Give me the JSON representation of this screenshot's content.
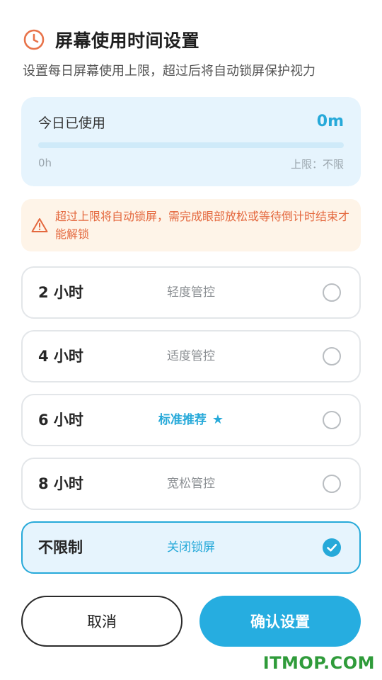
{
  "header": {
    "title": "屏幕使用时间设置",
    "subtitle": "设置每日屏幕使用上限，超过后将自动锁屏保护视力",
    "icon": "clock-icon",
    "accent_color": "#e8734a"
  },
  "usage": {
    "label": "今日已使用",
    "value": "0m",
    "progress_fraction": 0,
    "scale_start": "0h",
    "scale_end": "上限：不限"
  },
  "warning": {
    "icon": "warning-icon",
    "text": "超过上限将自动锁屏，需完成眼部放松或等待倒计时结束才能解锁"
  },
  "options": [
    {
      "label": "2 小时",
      "desc": "轻度管控",
      "selected": false
    },
    {
      "label": "4 小时",
      "desc": "适度管控",
      "selected": false
    },
    {
      "label": "6 小时",
      "desc": "标准推荐",
      "desc_icon": "star-icon",
      "selected": false
    },
    {
      "label": "8 小时",
      "desc": "宽松管控",
      "selected": false
    },
    {
      "label": "不限制",
      "desc": "关闭锁屏",
      "selected": true
    }
  ],
  "buttons": {
    "cancel": "取消",
    "confirm": "确认设置"
  },
  "colors": {
    "accent": "#26a9d9",
    "warning_text": "#e4683e",
    "warning_bg": "#fef4e8",
    "card_bg": "#e6f4fd"
  },
  "watermark": "ITMOP.COM"
}
